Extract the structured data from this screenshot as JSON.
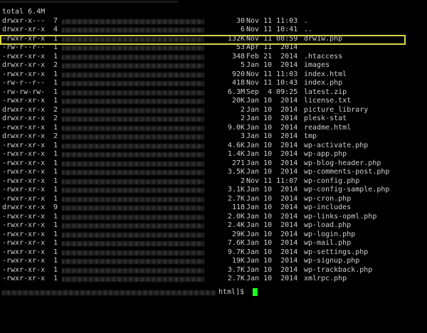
{
  "header": "total 6.4M",
  "rows": [
    {
      "perm": "drwxr-x---",
      "links": "7",
      "size": "30",
      "date": "Nov 11 11:03",
      "name": "."
    },
    {
      "perm": "drwxr-xr-x",
      "links": "4",
      "size": "6",
      "date": "Nov 11 10:41",
      "name": ".."
    },
    {
      "perm": "-rwxr-xr-x",
      "links": "1",
      "size": "132K",
      "date": "Nov 11 08:59",
      "name": "drw1w.php"
    },
    {
      "perm": "-rw-r--r--",
      "links": "1",
      "size": "53",
      "date": "Apr 11  2014",
      "name": ""
    },
    {
      "perm": "-rwxr-xr-x",
      "links": "1",
      "size": "348",
      "date": "Feb 21  2014",
      "name": ".htaccess"
    },
    {
      "perm": "drwxr-xr-x",
      "links": "2",
      "size": "5",
      "date": "Jan 10  2014",
      "name": "images"
    },
    {
      "perm": "-rwxr-xr-x",
      "links": "1",
      "size": "920",
      "date": "Nov 11 11:03",
      "name": "index.html"
    },
    {
      "perm": "-rw-r--r--",
      "links": "1",
      "size": "418",
      "date": "Nov 11 10:43",
      "name": "index.php"
    },
    {
      "perm": "-rw-rw-rw-",
      "links": "1",
      "size": "6.3M",
      "date": "Sep  4 09:25",
      "name": "latest.zip"
    },
    {
      "perm": "-rwxr-xr-x",
      "links": "1",
      "size": "20K",
      "date": "Jan 10  2014",
      "name": "license.txt"
    },
    {
      "perm": "drwxr-xr-x",
      "links": "2",
      "size": "2",
      "date": "Jan 10  2014",
      "name": "picture_library"
    },
    {
      "perm": "drwxr-xr-x",
      "links": "2",
      "size": "2",
      "date": "Jan 10  2014",
      "name": "plesk-stat"
    },
    {
      "perm": "-rwxr-xr-x",
      "links": "1",
      "size": "9.0K",
      "date": "Jan 10  2014",
      "name": "readme.html"
    },
    {
      "perm": "drwxr-xr-x",
      "links": "2",
      "size": "3",
      "date": "Jan 10  2014",
      "name": "tmp"
    },
    {
      "perm": "-rwxr-xr-x",
      "links": "1",
      "size": "4.6K",
      "date": "Jan 10  2014",
      "name": "wp-activate.php"
    },
    {
      "perm": "-rwxr-xr-x",
      "links": "1",
      "size": "1.4K",
      "date": "Jan 10  2014",
      "name": "wp-app.php"
    },
    {
      "perm": "-rwxr-xr-x",
      "links": "1",
      "size": "271",
      "date": "Jan 10  2014",
      "name": "wp-blog-header.php"
    },
    {
      "perm": "-rwxr-xr-x",
      "links": "1",
      "size": "3.5K",
      "date": "Jan 10  2014",
      "name": "wp-comments-post.php"
    },
    {
      "perm": "-rwxr-xr-x",
      "links": "1",
      "size": "2",
      "date": "Nov 11 11:07",
      "name": "wp-config.php"
    },
    {
      "perm": "-rwxr-xr-x",
      "links": "1",
      "size": "3.1K",
      "date": "Jan 10  2014",
      "name": "wp-config-sample.php"
    },
    {
      "perm": "-rwxr-xr-x",
      "links": "1",
      "size": "2.7K",
      "date": "Jan 10  2014",
      "name": "wp-cron.php"
    },
    {
      "perm": "drwxr-xr-x",
      "links": "9",
      "size": "118",
      "date": "Jan 10  2014",
      "name": "wp-includes"
    },
    {
      "perm": "-rwxr-xr-x",
      "links": "1",
      "size": "2.0K",
      "date": "Jan 10  2014",
      "name": "wp-links-opml.php"
    },
    {
      "perm": "-rwxr-xr-x",
      "links": "1",
      "size": "2.4K",
      "date": "Jan 10  2014",
      "name": "wp-load.php"
    },
    {
      "perm": "-rwxr-xr-x",
      "links": "1",
      "size": "29K",
      "date": "Jan 10  2014",
      "name": "wp-login.php"
    },
    {
      "perm": "-rwxr-xr-x",
      "links": "1",
      "size": "7.6K",
      "date": "Jan 10  2014",
      "name": "wp-mail.php"
    },
    {
      "perm": "-rwxr-xr-x",
      "links": "1",
      "size": "9.7K",
      "date": "Jan 10  2014",
      "name": "wp-settings.php"
    },
    {
      "perm": "-rwxr-xr-x",
      "links": "1",
      "size": "19K",
      "date": "Jan 10  2014",
      "name": "wp-signup.php"
    },
    {
      "perm": "-rwxr-xr-x",
      "links": "1",
      "size": "3.7K",
      "date": "Jan 10  2014",
      "name": "wp-trackback.php"
    },
    {
      "perm": "-rwxr-xr-x",
      "links": "1",
      "size": "2.7K",
      "date": "Jan 10  2014",
      "name": "xmlrpc.php"
    }
  ],
  "highlighted_row": "drw1w.php",
  "prompt": "html]$",
  "colors": {
    "background": "#000000",
    "text": "#cfcfcf",
    "highlight_border": "#d6d64a",
    "cursor": "#1cff1c"
  }
}
